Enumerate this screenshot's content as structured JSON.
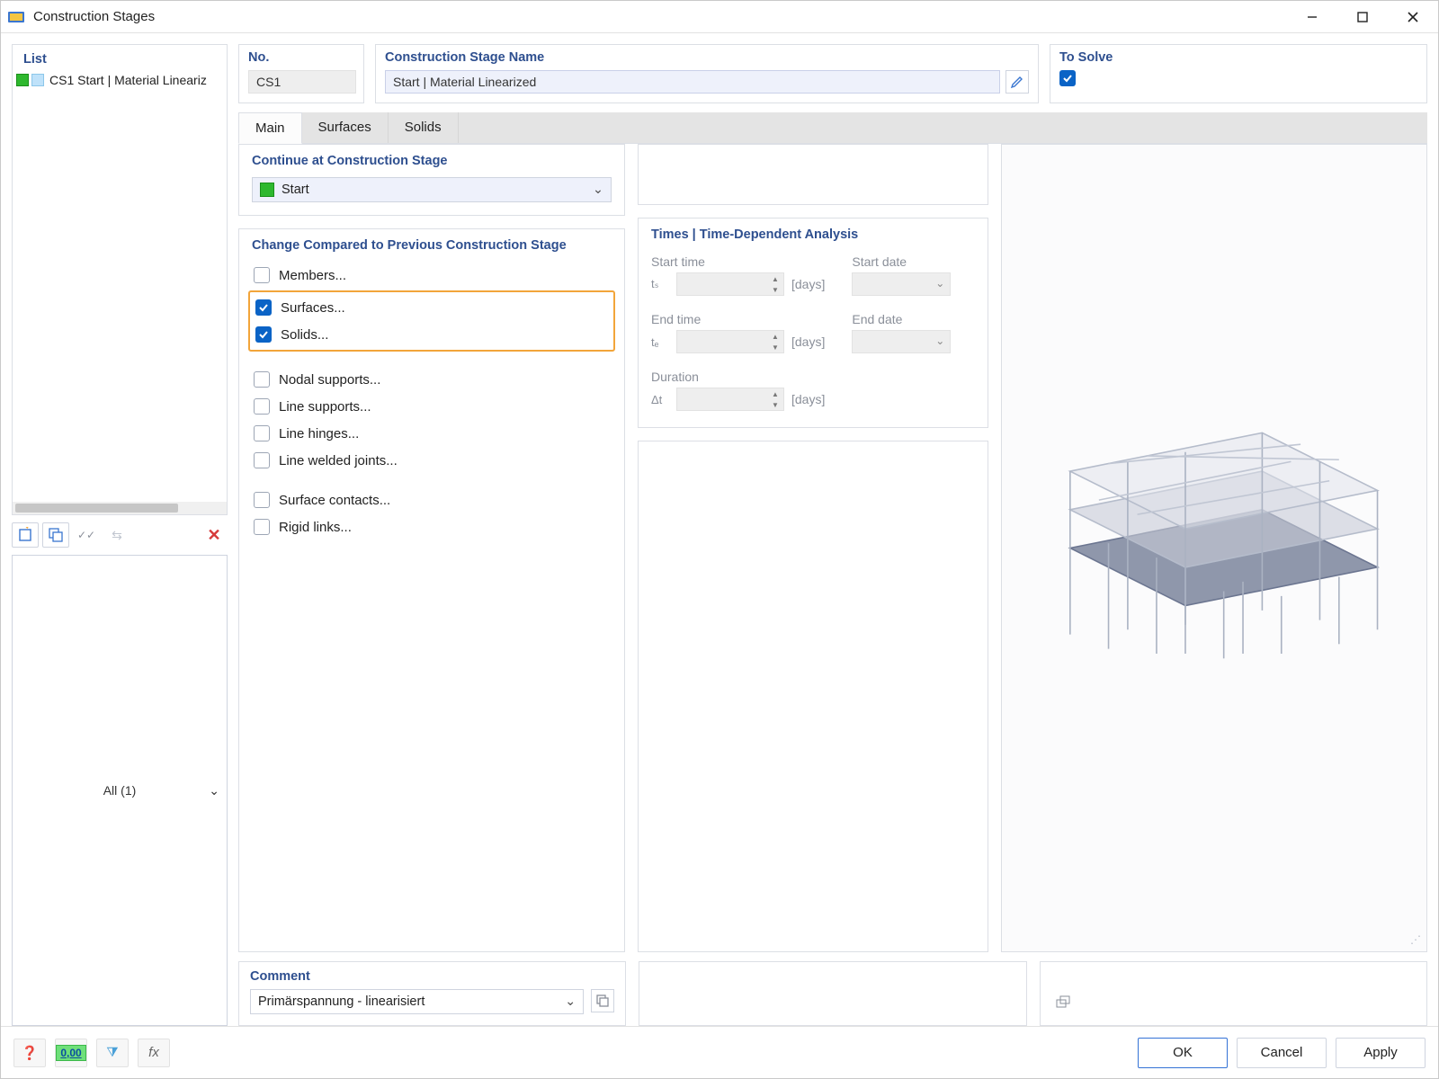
{
  "window": {
    "title": "Construction Stages"
  },
  "list": {
    "header": "List",
    "items": [
      {
        "label": "CS1  Start | Material Lineariz"
      }
    ],
    "filter": "All (1)"
  },
  "header_fields": {
    "no_label": "No.",
    "no_value": "CS1",
    "name_label": "Construction Stage Name",
    "name_value": "Start | Material Linearized",
    "solve_label": "To Solve",
    "solve_checked": true
  },
  "tabs": {
    "items": [
      "Main",
      "Surfaces",
      "Solids"
    ],
    "active": 0
  },
  "continue_group": {
    "title": "Continue at Construction Stage",
    "value": "Start"
  },
  "changes_group": {
    "title": "Change Compared to Previous Construction Stage",
    "items_top": [
      {
        "label": "Members...",
        "checked": false
      }
    ],
    "items_highlight": [
      {
        "label": "Surfaces...",
        "checked": true
      },
      {
        "label": "Solids...",
        "checked": true
      }
    ],
    "items_mid": [
      {
        "label": "Nodal supports...",
        "checked": false
      },
      {
        "label": "Line supports...",
        "checked": false
      },
      {
        "label": "Line hinges...",
        "checked": false
      },
      {
        "label": "Line welded joints...",
        "checked": false
      }
    ],
    "items_bot": [
      {
        "label": "Surface contacts...",
        "checked": false
      },
      {
        "label": "Rigid links...",
        "checked": false
      }
    ]
  },
  "times_group": {
    "title": "Times | Time-Dependent Analysis",
    "start_time_label": "Start time",
    "start_time_sym": "tₛ",
    "start_date_label": "Start date",
    "end_time_label": "End time",
    "end_time_sym": "tₑ",
    "end_date_label": "End date",
    "duration_label": "Duration",
    "duration_sym": "Δt",
    "unit_days": "[days]"
  },
  "comment": {
    "label": "Comment",
    "value": "Primärspannung - linearisiert"
  },
  "footer": {
    "ok": "OK",
    "cancel": "Cancel",
    "apply": "Apply",
    "badge": "0,00"
  }
}
